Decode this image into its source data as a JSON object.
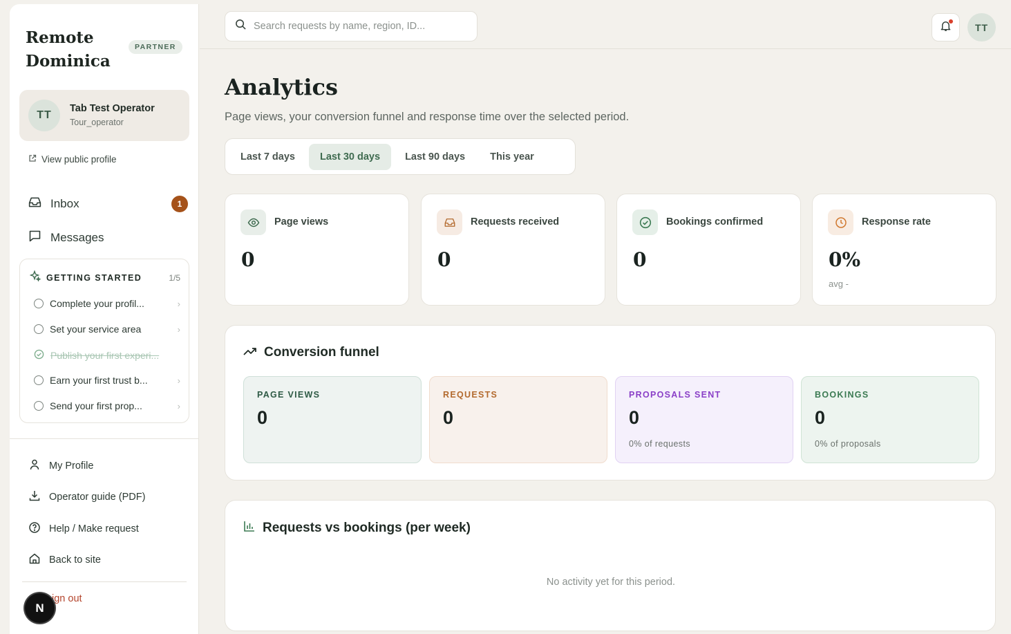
{
  "sidebar": {
    "brand_line1": "Remote",
    "brand_line2": "Dominica",
    "badge": "PARTNER",
    "user": {
      "initials": "TT",
      "name": "Tab Test Operator",
      "role": "Tour_operator"
    },
    "public_profile_link": "View public profile",
    "nav": {
      "inbox": "Inbox",
      "inbox_count": "1",
      "messages": "Messages"
    },
    "getting_started": {
      "title": "GETTING STARTED",
      "progress": "1/5",
      "items": [
        {
          "label": "Complete your profil...",
          "done": false
        },
        {
          "label": "Set your service area",
          "done": false
        },
        {
          "label": "Publish your first experi...",
          "done": true
        },
        {
          "label": "Earn your first trust b...",
          "done": false
        },
        {
          "label": "Send your first prop...",
          "done": false
        }
      ]
    },
    "footer": {
      "my_profile": "My Profile",
      "guide": "Operator guide (PDF)",
      "help": "Help / Make request",
      "back": "Back to site",
      "sign_out": "ign out"
    },
    "fab_letter": "N"
  },
  "topbar": {
    "search_placeholder": "Search requests by name, region, ID...",
    "avatar_initials": "TT"
  },
  "main": {
    "title": "Analytics",
    "subtitle": "Page views, your conversion funnel and response time over the selected period.",
    "tabs": [
      "Last 7 days",
      "Last 30 days",
      "Last 90 days",
      "This year"
    ],
    "active_tab": "Last 30 days",
    "stats": [
      {
        "label": "Page views",
        "value": "0",
        "icon": "eye-icon"
      },
      {
        "label": "Requests received",
        "value": "0",
        "icon": "inbox-icon"
      },
      {
        "label": "Bookings confirmed",
        "value": "0",
        "icon": "check-circle-icon"
      },
      {
        "label": "Response rate",
        "value": "0%",
        "sub": "avg -",
        "icon": "clock-icon"
      }
    ],
    "funnel": {
      "title": "Conversion funnel",
      "steps": [
        {
          "label": "PAGE VIEWS",
          "value": "0",
          "note": ""
        },
        {
          "label": "REQUESTS",
          "value": "0",
          "note": ""
        },
        {
          "label": "PROPOSALS SENT",
          "value": "0",
          "note": "0% of requests"
        },
        {
          "label": "BOOKINGS",
          "value": "0",
          "note": "0% of proposals"
        }
      ]
    },
    "weekly": {
      "title": "Requests vs bookings (per week)",
      "empty": "No activity yet for this period."
    }
  },
  "colors": {
    "accent_green": "#3f6b50",
    "badge_brown": "#a5521a",
    "funnel_views": "#2e5a45",
    "funnel_requests": "#b36a2e",
    "funnel_proposals": "#8a3fc7",
    "funnel_bookings": "#3b7a52"
  }
}
